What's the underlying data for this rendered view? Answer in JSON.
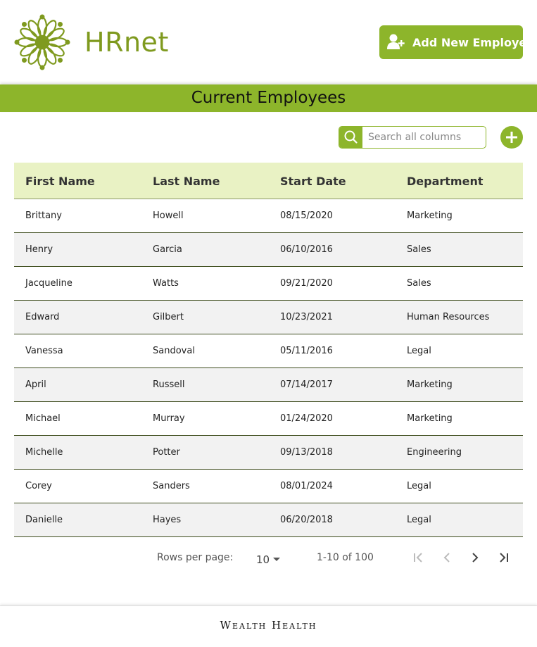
{
  "header": {
    "brand": "HRnet",
    "add_button_label": "Add New Employee",
    "accent_color": "#8db52b",
    "logo_color": "#7f9a1f"
  },
  "page_title": "Current Employees",
  "search": {
    "placeholder": "Search all columns",
    "value": ""
  },
  "table": {
    "columns": [
      "First Name",
      "Last Name",
      "Start Date",
      "Department"
    ],
    "rows": [
      [
        "Brittany",
        "Howell",
        "08/15/2020",
        "Marketing"
      ],
      [
        "Henry",
        "Garcia",
        "06/10/2016",
        "Sales"
      ],
      [
        "Jacqueline",
        "Watts",
        "09/21/2020",
        "Sales"
      ],
      [
        "Edward",
        "Gilbert",
        "10/23/2021",
        "Human Resources"
      ],
      [
        "Vanessa",
        "Sandoval",
        "05/11/2016",
        "Legal"
      ],
      [
        "April",
        "Russell",
        "07/14/2017",
        "Marketing"
      ],
      [
        "Michael",
        "Murray",
        "01/24/2020",
        "Marketing"
      ],
      [
        "Michelle",
        "Potter",
        "09/13/2018",
        "Engineering"
      ],
      [
        "Corey",
        "Sanders",
        "08/01/2024",
        "Legal"
      ],
      [
        "Danielle",
        "Hayes",
        "06/20/2018",
        "Legal"
      ]
    ]
  },
  "pagination": {
    "rows_per_page_label": "Rows per page:",
    "rows_per_page_value": "10",
    "range_label": "1-10 of 100",
    "icons": [
      "first-page-icon",
      "previous-page-icon",
      "next-page-icon",
      "last-page-icon"
    ]
  },
  "footer": {
    "company": "Wealth Health"
  }
}
